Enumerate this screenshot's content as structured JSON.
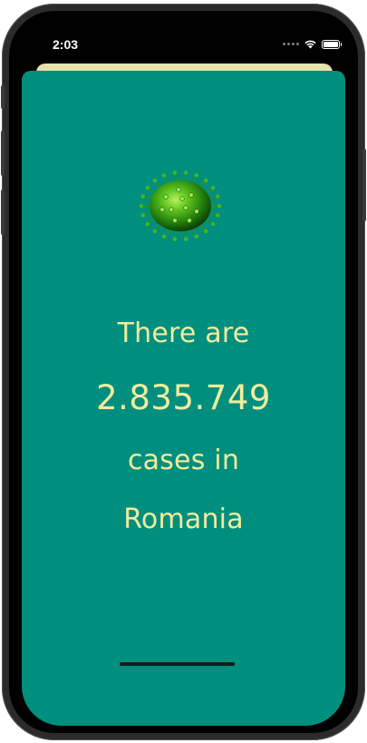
{
  "status_bar": {
    "time": "2:03",
    "icons": [
      "cellular-dots-icon",
      "wifi-icon",
      "battery-icon"
    ],
    "battery_level": 1.0
  },
  "main": {
    "line_1": "There are",
    "cases_count": "2.835.749",
    "line_3": "cases in",
    "country": "Romania",
    "icon": "virus-icon"
  },
  "colors": {
    "background": "#008f7f",
    "text": "#f1ec9c",
    "behind_sheet": "#e7e2a9",
    "virus_green": "#3fae1c"
  }
}
